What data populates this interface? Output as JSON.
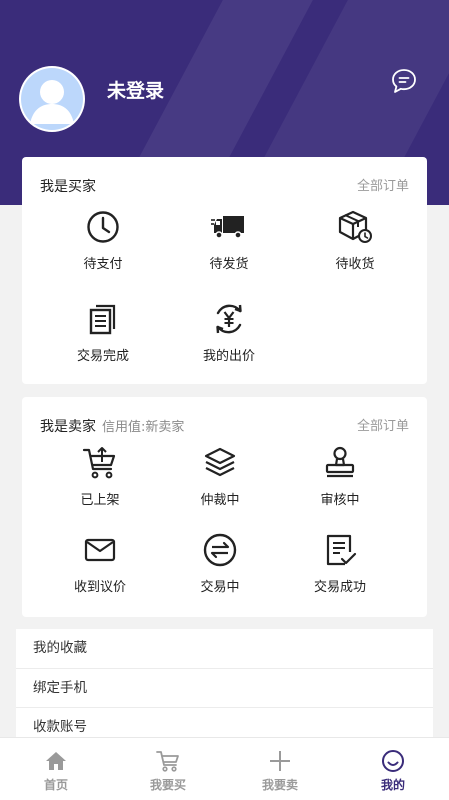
{
  "profile": {
    "name": "未登录"
  },
  "colors": {
    "brand": "#3a2c7a",
    "text": "#222222",
    "muted": "#9a9a9a",
    "background": "#f2f2f2"
  },
  "buyer": {
    "title": "我是买家",
    "all_orders": "全部订单",
    "items": [
      {
        "label": "待支付",
        "icon": "clock-icon"
      },
      {
        "label": "待发货",
        "icon": "truck-icon"
      },
      {
        "label": "待收货",
        "icon": "package-icon"
      },
      {
        "label": "交易完成",
        "icon": "documents-icon"
      },
      {
        "label": "我的出价",
        "icon": "yuan-cycle-icon"
      }
    ]
  },
  "seller": {
    "title": "我是卖家",
    "credit": "信用值:新卖家",
    "all_orders": "全部订单",
    "items": [
      {
        "label": "已上架",
        "icon": "cart-upload-icon"
      },
      {
        "label": "仲裁中",
        "icon": "layers-icon"
      },
      {
        "label": "审核中",
        "icon": "stamp-icon"
      },
      {
        "label": "收到议价",
        "icon": "envelope-icon"
      },
      {
        "label": "交易中",
        "icon": "exchange-icon"
      },
      {
        "label": "交易成功",
        "icon": "document-check-icon"
      }
    ]
  },
  "menu": [
    {
      "label": "我的收藏"
    },
    {
      "label": "绑定手机"
    },
    {
      "label": "收款账号"
    }
  ],
  "tabbar": [
    {
      "label": "首页",
      "icon": "home-icon",
      "active": false
    },
    {
      "label": "我要买",
      "icon": "cart-icon",
      "active": false
    },
    {
      "label": "我要卖",
      "icon": "plus-icon",
      "active": false
    },
    {
      "label": "我的",
      "icon": "smiley-icon",
      "active": true
    }
  ]
}
